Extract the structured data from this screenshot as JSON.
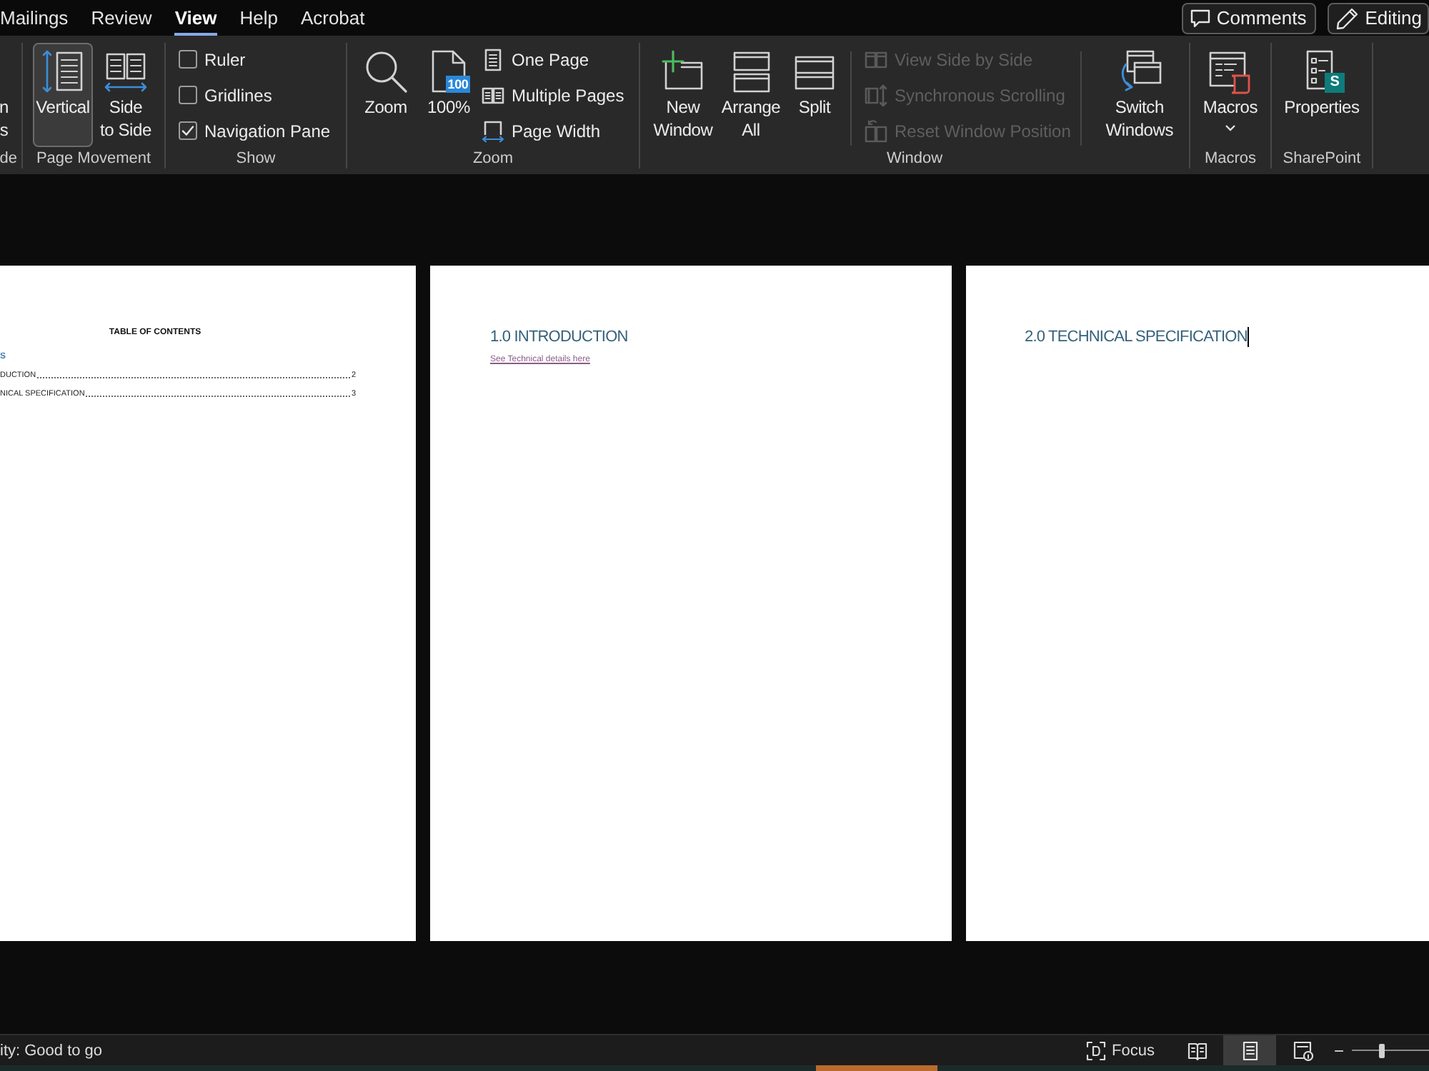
{
  "menu_tabs": [
    {
      "label": "Mailings",
      "selected": false
    },
    {
      "label": "Review",
      "selected": false
    },
    {
      "label": "View",
      "selected": true
    },
    {
      "label": "Help",
      "selected": false
    },
    {
      "label": "Acrobat",
      "selected": false
    }
  ],
  "header_buttons": [
    {
      "label": "Comments"
    },
    {
      "label": "Editing"
    }
  ],
  "ribbon": {
    "cut_group": {
      "button_label": "n\ns",
      "label": "de"
    },
    "page_movement": {
      "label": "Page Movement",
      "buttons": [
        {
          "label": "Vertical",
          "selected": true
        },
        {
          "label": "Side\nto Side",
          "selected": false
        }
      ]
    },
    "show": {
      "label": "Show",
      "checkboxes": [
        {
          "label": "Ruler",
          "checked": false
        },
        {
          "label": "Gridlines",
          "checked": false
        },
        {
          "label": "Navigation Pane",
          "checked": true
        }
      ]
    },
    "zoom": {
      "label": "Zoom",
      "large_buttons": [
        {
          "label": "Zoom"
        },
        {
          "label": "100%",
          "icon_badge": "100"
        }
      ],
      "small_buttons": [
        {
          "label": "One Page",
          "disabled": false
        },
        {
          "label": "Multiple Pages",
          "disabled": false
        },
        {
          "label": "Page Width",
          "disabled": false
        }
      ]
    },
    "window": {
      "label": "Window",
      "large_buttons": [
        {
          "label": "New\nWindow"
        },
        {
          "label": "Arrange\nAll"
        },
        {
          "label": "Split"
        }
      ],
      "small_buttons": [
        {
          "label": "View Side by Side",
          "disabled": true
        },
        {
          "label": "Synchronous Scrolling",
          "disabled": true
        },
        {
          "label": "Reset Window Position",
          "disabled": true
        }
      ],
      "switch_button": {
        "label": "Switch\nWindows"
      }
    },
    "macros": {
      "label": "Macros",
      "button": {
        "label": "Macros"
      }
    },
    "sharepoint": {
      "label": "SharePoint",
      "button": {
        "label": "Properties",
        "icon_badge": "S"
      }
    }
  },
  "document": {
    "toc_page": {
      "title": "TABLE OF CONTENTS",
      "heading": "S",
      "entries": [
        {
          "title": "DUCTION",
          "page": "2"
        },
        {
          "title": "NICAL SPECIFICATION",
          "page": "3"
        }
      ]
    },
    "pages": [
      {
        "heading": "1.0 INTRODUCTION",
        "link": "See Technical details here",
        "text_cursor": false
      },
      {
        "heading": "2.0 TECHNICAL SPECIFICATION",
        "text_cursor": true
      }
    ]
  },
  "status_bar": {
    "text": "ity: Good to go",
    "focus_label": "Focus",
    "view_buttons": [
      {
        "selected": false
      },
      {
        "selected": true
      },
      {
        "selected": false
      }
    ],
    "zoom_out": "−",
    "zoom_slider": {
      "level": 0.39
    }
  }
}
